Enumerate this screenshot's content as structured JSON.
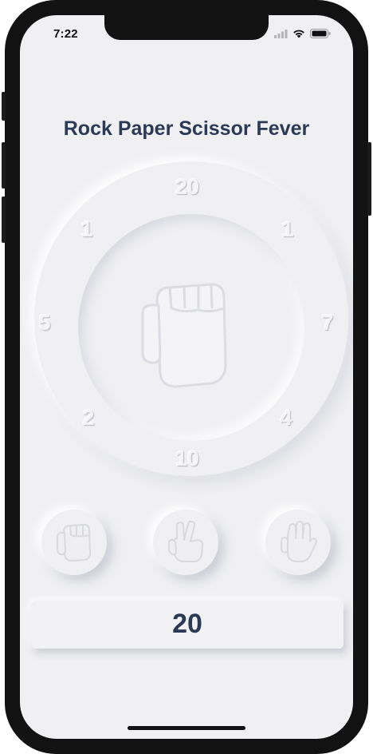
{
  "status_bar": {
    "time": "7:22",
    "icons": [
      "signal-icon",
      "wifi-icon",
      "battery-icon"
    ]
  },
  "app": {
    "title": "Rock Paper Scissor Fever"
  },
  "dial": {
    "center_icon": "fist-icon",
    "numbers": {
      "top": "20",
      "top_left": "1",
      "top_right": "1",
      "left": "5",
      "right": "7",
      "bottom_left": "2",
      "bottom_right": "4",
      "bottom": "10"
    }
  },
  "choices": [
    {
      "name": "rock",
      "icon": "rock-hand-icon"
    },
    {
      "name": "scissors",
      "icon": "scissors-hand-icon"
    },
    {
      "name": "paper",
      "icon": "paper-hand-icon"
    }
  ],
  "score": {
    "value": "20"
  },
  "colors": {
    "background": "#f0f0f3",
    "title": "#2b3a55",
    "frame": "#121212"
  }
}
